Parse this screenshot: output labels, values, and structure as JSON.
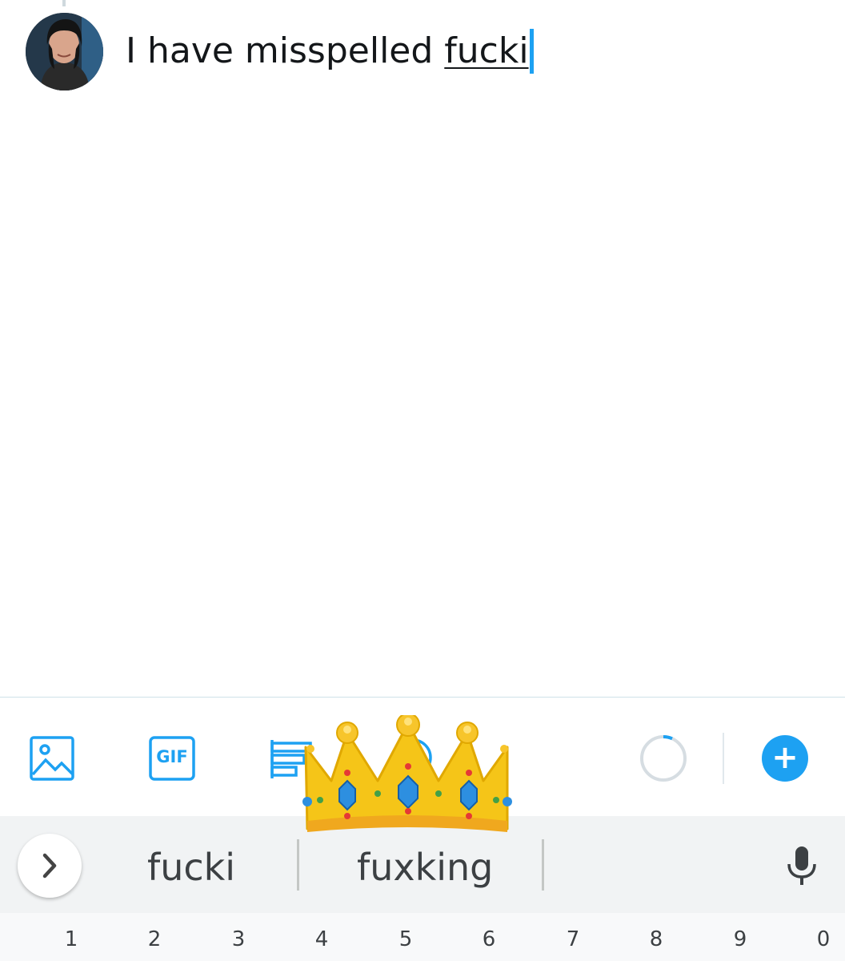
{
  "compose": {
    "text_before": "I have misspelled ",
    "misspelled_word": "fucki"
  },
  "toolbar": {
    "image_icon": "image-icon",
    "gif_label": "GIF",
    "poll_icon": "poll-icon",
    "location_icon": "location-icon",
    "add_tweet_label": "+"
  },
  "keyboard": {
    "suggestions": [
      "fucki",
      "fuxking"
    ],
    "number_row": [
      "1",
      "2",
      "3",
      "4",
      "5",
      "6",
      "7",
      "8",
      "9",
      "0"
    ]
  },
  "colors": {
    "accent": "#1da1f2",
    "crown_gold": "#f5c518"
  }
}
